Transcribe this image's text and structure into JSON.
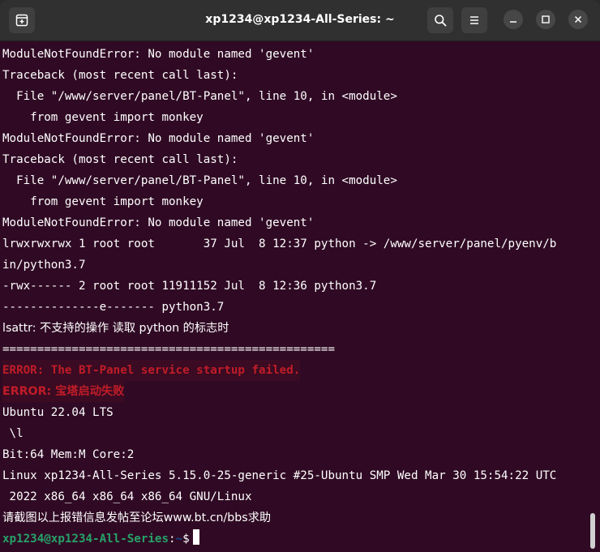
{
  "window": {
    "title": "xp1234@xp1234-All-Series: ~",
    "icons": {
      "new_tab": "new-tab-icon",
      "search": "search-icon",
      "menu": "hamburger-menu-icon",
      "minimize": "minimize-icon",
      "maximize": "maximize-icon",
      "close": "close-icon"
    }
  },
  "terminal": {
    "lines": [
      "ModuleNotFoundError: No module named 'gevent'",
      "Traceback (most recent call last):",
      "  File \"/www/server/panel/BT-Panel\", line 10, in <module>",
      "    from gevent import monkey",
      "ModuleNotFoundError: No module named 'gevent'",
      "Traceback (most recent call last):",
      "  File \"/www/server/panel/BT-Panel\", line 10, in <module>",
      "    from gevent import monkey",
      "ModuleNotFoundError: No module named 'gevent'",
      "lrwxrwxrwx 1 root root       37 Jul  8 12:37 python -> /www/server/panel/pyenv/b",
      "in/python3.7",
      "-rwx------ 2 root root 11911152 Jul  8 12:36 python3.7",
      "--------------e------- python3.7",
      "lsattr: 不支持的操作 读取 python 的标志时",
      "================================================",
      "ERROR: The BT-Panel service startup failed.",
      "ERROR: 宝塔启动失败",
      "Ubuntu 22.04 LTS",
      " \\l",
      "Bit:64 Mem:M Core:2",
      "Linux xp1234-All-Series 5.15.0-25-generic #25-Ubuntu SMP Wed Mar 30 15:54:22 UTC",
      " 2022 x86_64 x86_64 x86_64 GNU/Linux",
      "请截图以上报错信息发帖至论坛www.bt.cn/bbs求助"
    ],
    "prompt": {
      "user_host": "xp1234@xp1234-All-Series",
      "separator": ":",
      "path": "~",
      "symbol": "$"
    }
  },
  "colors": {
    "background": "#300a24",
    "error_red": "#c01c28",
    "prompt_green": "#26a269",
    "prompt_blue": "#12488b"
  }
}
